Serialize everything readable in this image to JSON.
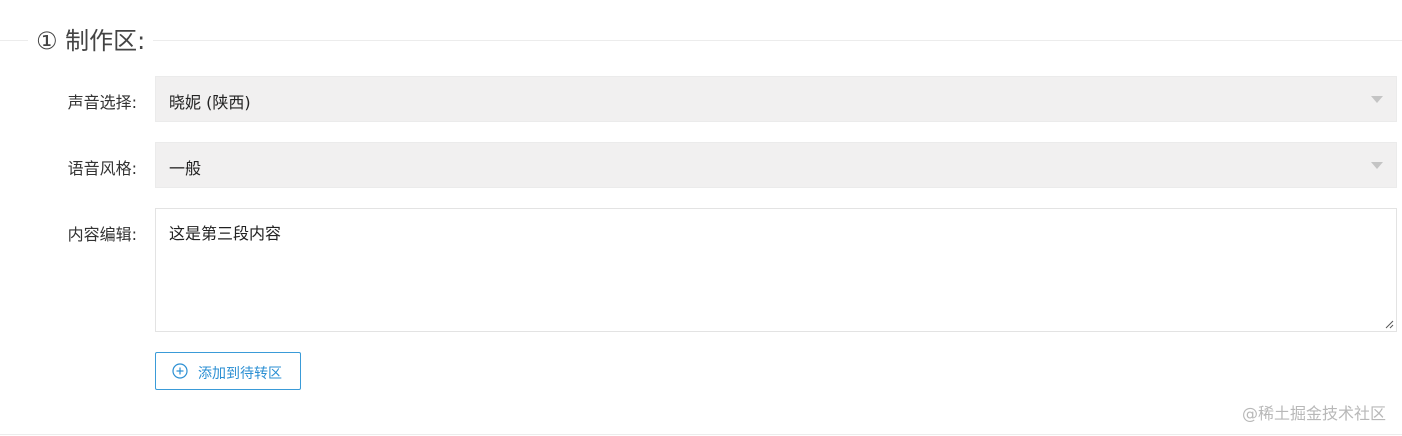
{
  "section": {
    "title": "① 制作区:"
  },
  "voice_select": {
    "label": "声音选择:",
    "value": "晓妮 (陕西)"
  },
  "style_select": {
    "label": "语音风格:",
    "value": "一般"
  },
  "content_editor": {
    "label": "内容编辑:",
    "value": "这是第三段内容"
  },
  "add_button": {
    "label": "添加到待转区",
    "icon": "plus-circle-icon"
  },
  "watermark": {
    "text": "@稀土掘金技术社区"
  },
  "colors": {
    "accent": "#2b8fd3",
    "select_bg": "#f1f0f0",
    "divider": "#ececec"
  }
}
